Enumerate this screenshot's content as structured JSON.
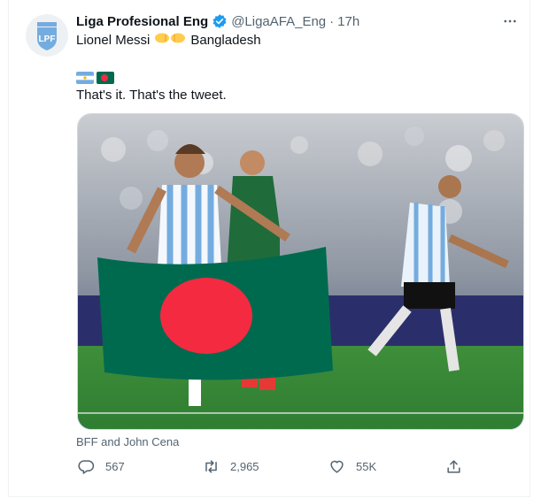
{
  "tweet": {
    "display_name": "Liga Profesional Eng",
    "handle": "@LigaAFA_Eng",
    "separator": "·",
    "time": "17h",
    "line1_prefix": "Lionel Messi",
    "line1_suffix": "Bangladesh",
    "body": "That's it. That's the tweet.",
    "caption": "BFF and John Cena"
  },
  "metrics": {
    "replies": "567",
    "retweets": "2,965",
    "likes": "55K"
  },
  "icons": {
    "avatar": "lpf-logo-icon",
    "verified": "verified-badge-icon",
    "more": "more-options-icon",
    "reply": "reply-icon",
    "retweet": "retweet-icon",
    "like": "heart-icon",
    "share": "share-icon"
  },
  "colors": {
    "accent": "#1d9bf0",
    "muted": "#536471",
    "bangladesh_green": "#006a4e",
    "bangladesh_red": "#f42a41",
    "argentina_blue": "#74acdf",
    "pitch_green": "#2f7d32"
  }
}
